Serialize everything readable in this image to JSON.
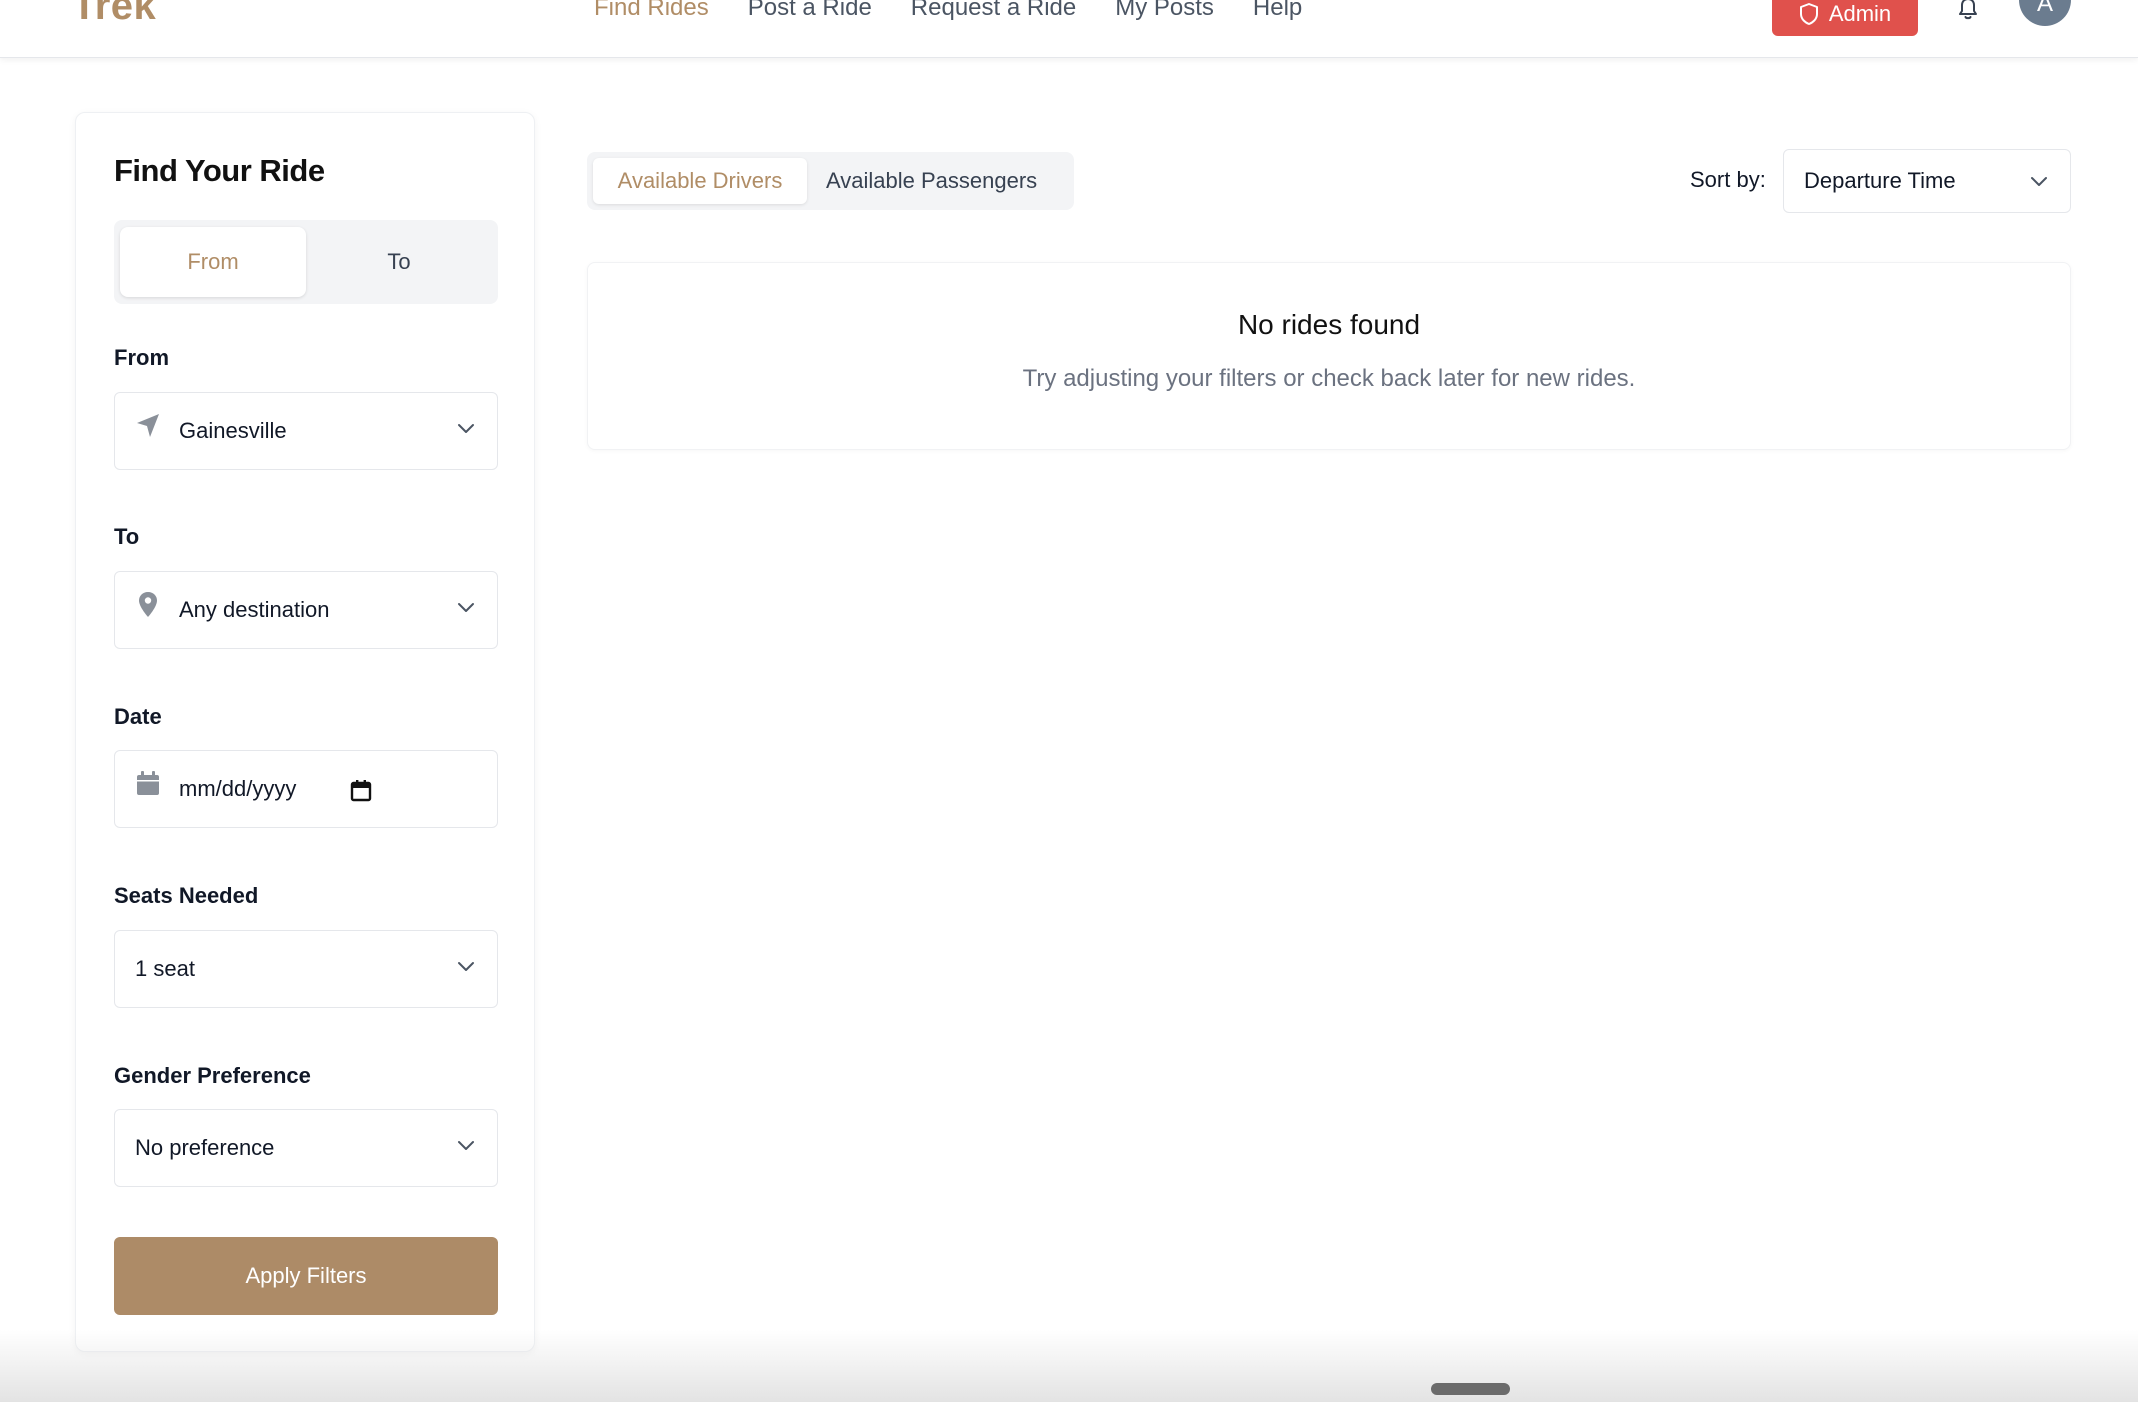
{
  "header": {
    "logo": "Trek",
    "nav": [
      {
        "label": "Find Rides",
        "active": true
      },
      {
        "label": "Post a Ride",
        "active": false
      },
      {
        "label": "Request a Ride",
        "active": false
      },
      {
        "label": "My Posts",
        "active": false
      },
      {
        "label": "Help",
        "active": false
      }
    ],
    "admin_label": "Admin",
    "avatar_initial": "A"
  },
  "sidebar": {
    "title": "Find Your Ride",
    "toggle": {
      "from": "From",
      "to": "To"
    },
    "from": {
      "label": "From",
      "value": "Gainesville",
      "icon": "navigation-arrow-icon"
    },
    "to": {
      "label": "To",
      "value": "Any destination",
      "icon": "map-pin-icon"
    },
    "date": {
      "label": "Date",
      "placeholder": "mm/dd/yyyy",
      "icon": "calendar-icon"
    },
    "seats": {
      "label": "Seats Needed",
      "value": "1 seat"
    },
    "gender": {
      "label": "Gender Preference",
      "value": "No preference"
    },
    "apply_label": "Apply Filters"
  },
  "main": {
    "tabs": {
      "drivers": "Available Drivers",
      "passengers": "Available Passengers"
    },
    "sort": {
      "label": "Sort by:",
      "value": "Departure Time"
    },
    "empty": {
      "title": "No rides found",
      "subtitle": "Try adjusting your filters or check back later for new rides."
    }
  },
  "colors": {
    "brand": "#b08d66",
    "admin": "#e0514c",
    "apply": "#ad8b67"
  }
}
